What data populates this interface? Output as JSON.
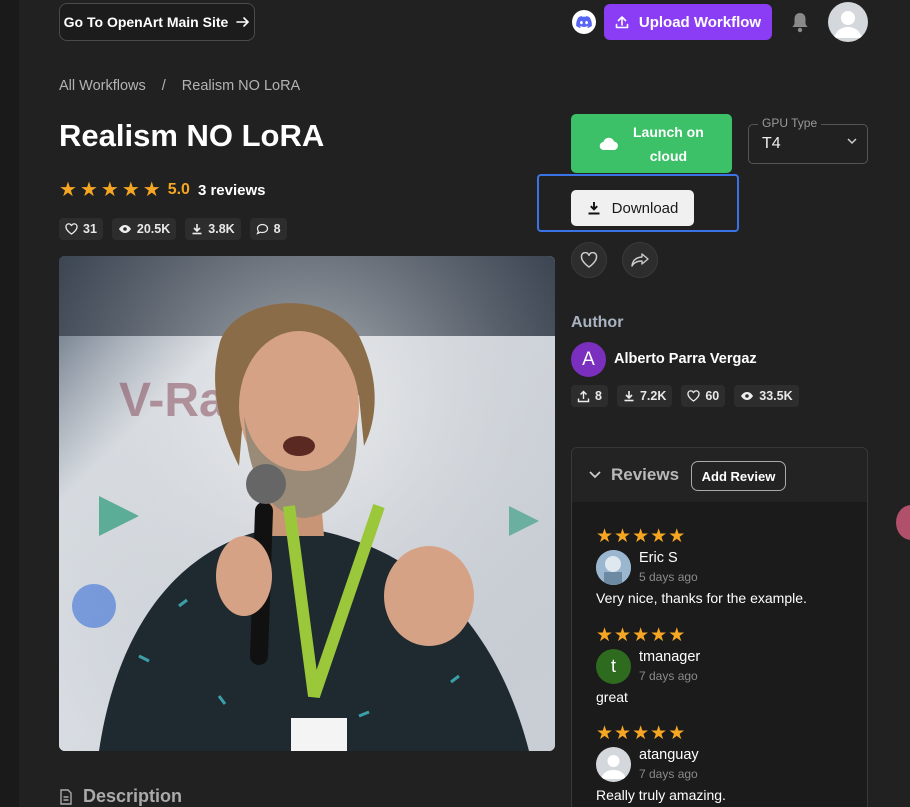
{
  "header": {
    "main_site_label": "Go To OpenArt Main Site",
    "upload_label": "Upload Workflow"
  },
  "breadcrumb": {
    "root": "All Workflows",
    "separator": "/",
    "current": "Realism NO LoRA"
  },
  "workflow": {
    "title": "Realism NO LoRA",
    "rating": "5.0",
    "rating_stars": 5,
    "reviews_label": "3 reviews",
    "stats": {
      "likes": "31",
      "views": "20.5K",
      "downloads": "3.8K",
      "comments": "8"
    }
  },
  "actions": {
    "launch_line1": "Launch on",
    "launch_line2": "cloud",
    "gpu_label": "GPU Type",
    "gpu_value": "T4",
    "download_label": "Download"
  },
  "author": {
    "section_label": "Author",
    "initial": "A",
    "name": "Alberto Parra Vergaz",
    "stats": {
      "uploads": "8",
      "downloads": "7.2K",
      "likes": "60",
      "views": "33.5K"
    }
  },
  "reviews": {
    "title": "Reviews",
    "add_label": "Add Review",
    "items": [
      {
        "stars": 5,
        "name": "Eric S",
        "time": "5 days ago",
        "text": "Very nice, thanks for the example."
      },
      {
        "stars": 5,
        "name": "tmanager",
        "initial": "t",
        "time": "7 days ago",
        "text": "great"
      },
      {
        "stars": 5,
        "name": "atanguay",
        "time": "7 days ago",
        "text": "Really truly amazing."
      }
    ]
  },
  "description": {
    "label": "Description"
  },
  "colors": {
    "background": "#212121",
    "upload_purple": "#8b3df5",
    "launch_green": "#3cc168",
    "star_orange": "#f5a623",
    "highlight_blue": "#3b73e6",
    "author_purple": "#7b2fbe",
    "reviewer_green": "#2e6b1f"
  },
  "icons": [
    "arrow-right-icon",
    "discord-icon",
    "upload-icon",
    "bell-icon",
    "user-icon",
    "star-icon",
    "heart-icon",
    "eye-icon",
    "download-icon",
    "comment-icon",
    "cloud-icon",
    "chevron-down-icon",
    "share-icon",
    "document-icon"
  ]
}
